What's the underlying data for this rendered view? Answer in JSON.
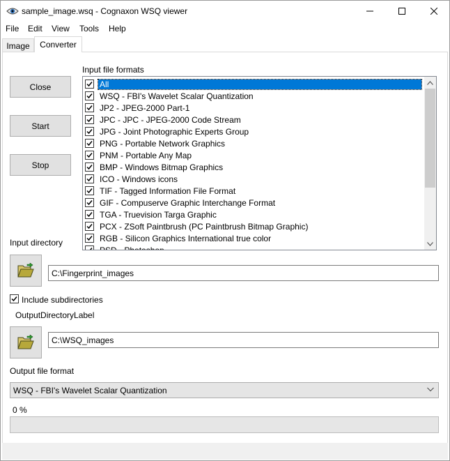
{
  "window": {
    "title": "sample_image.wsq - Cognaxon WSQ viewer",
    "icon": "eye-icon"
  },
  "menu": [
    "File",
    "Edit",
    "View",
    "Tools",
    "Help"
  ],
  "tabs": [
    {
      "label": "Image",
      "active": false
    },
    {
      "label": "Converter",
      "active": true
    }
  ],
  "buttons": {
    "close": "Close",
    "start": "Start",
    "stop": "Stop"
  },
  "input_formats": {
    "label": "Input file formats",
    "items": [
      {
        "label": "All",
        "checked": true,
        "selected": true
      },
      {
        "label": "WSQ - FBI's Wavelet Scalar Quantization",
        "checked": true
      },
      {
        "label": "JP2 - JPEG-2000 Part-1",
        "checked": true
      },
      {
        "label": "JPC - JPC - JPEG-2000 Code Stream",
        "checked": true
      },
      {
        "label": "JPG - Joint Photographic Experts Group",
        "checked": true
      },
      {
        "label": "PNG - Portable Network Graphics",
        "checked": true
      },
      {
        "label": "PNM - Portable Any Map",
        "checked": true
      },
      {
        "label": "BMP - Windows Bitmap Graphics",
        "checked": true
      },
      {
        "label": "ICO - Windows icons",
        "checked": true
      },
      {
        "label": "TIF - Tagged Information File Format",
        "checked": true
      },
      {
        "label": "GIF - Compuserve Graphic Interchange Format",
        "checked": true
      },
      {
        "label": "TGA - Truevision Targa Graphic",
        "checked": true
      },
      {
        "label": "PCX - ZSoft Paintbrush (PC Paintbrush Bitmap Graphic)",
        "checked": true
      },
      {
        "label": "RGB - Silicon Graphics International true color",
        "checked": true
      },
      {
        "label": "PSD - Photoshop",
        "checked": true
      }
    ]
  },
  "input_directory": {
    "label": "Input directory",
    "value": "C:\\Fingerprint_images",
    "icon": "open-folder-icon"
  },
  "include_subdirectories": {
    "label": "Include subdirectories",
    "checked": true
  },
  "output_directory": {
    "label": "OutputDirectoryLabel",
    "value": "C:\\WSQ_images",
    "icon": "open-folder-icon"
  },
  "output_format": {
    "label": "Output file format",
    "selected": "WSQ - FBI's Wavelet Scalar Quantization"
  },
  "progress": {
    "text": "0 %",
    "fraction": 0
  },
  "colors": {
    "selection": "#0078d7",
    "button_face": "#e1e1e1",
    "window_bg": "#ffffff"
  }
}
